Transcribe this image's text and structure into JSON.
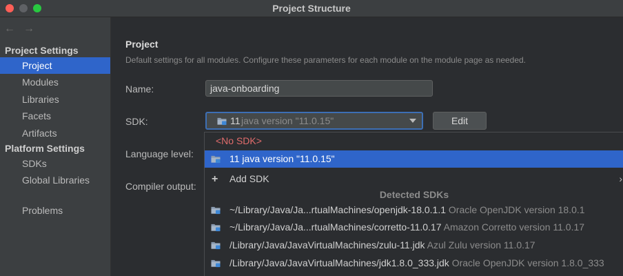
{
  "window": {
    "title": "Project Structure"
  },
  "nav": {
    "back": "←",
    "forward": "→"
  },
  "sidebar": {
    "group_project_settings": "Project Settings",
    "project_items": [
      {
        "label": "Project",
        "selected": true
      },
      {
        "label": "Modules"
      },
      {
        "label": "Libraries"
      },
      {
        "label": "Facets"
      },
      {
        "label": "Artifacts"
      }
    ],
    "group_platform_settings": "Platform Settings",
    "platform_items": [
      {
        "label": "SDKs"
      },
      {
        "label": "Global Libraries"
      }
    ],
    "problems": "Problems"
  },
  "main": {
    "heading": "Project",
    "description": "Default settings for all modules. Configure these parameters for each module on the module page as needed.",
    "name_label": "Name:",
    "name_value": "java-onboarding",
    "sdk_label": "SDK:",
    "sdk_selected_num": "11",
    "sdk_selected_version": "java version \"11.0.15\"",
    "edit_button": "Edit",
    "language_level_label": "Language level:",
    "compiler_output_label": "Compiler output:"
  },
  "dropdown": {
    "no_sdk": "<No SDK>",
    "selected_item": "11 java version \"11.0.15\"",
    "add_sdk": "Add SDK",
    "add_sdk_icon": "+",
    "add_sdk_chevron": "›",
    "detected_header": "Detected SDKs",
    "detected": [
      {
        "path": "~/Library/Java/Ja...rtualMachines/openjdk-18.0.1.1",
        "desc": "Oracle OpenJDK version 18.0.1"
      },
      {
        "path": "~/Library/Java/Ja...rtualMachines/corretto-11.0.17",
        "desc": "Amazon Corretto version 11.0.17"
      },
      {
        "path": "/Library/Java/JavaVirtualMachines/zulu-11.jdk",
        "desc": "Azul Zulu version 11.0.17"
      },
      {
        "path": "/Library/Java/JavaVirtualMachines/jdk1.8.0_333.jdk",
        "desc": "Oracle OpenJDK version 1.8.0_333"
      }
    ]
  },
  "colors": {
    "accent": "#2f65ca",
    "focus_border": "#3d6fb5",
    "error_text": "#e06c6c",
    "background": "#2b2d30",
    "sidebar_bg": "#3c3f41"
  }
}
